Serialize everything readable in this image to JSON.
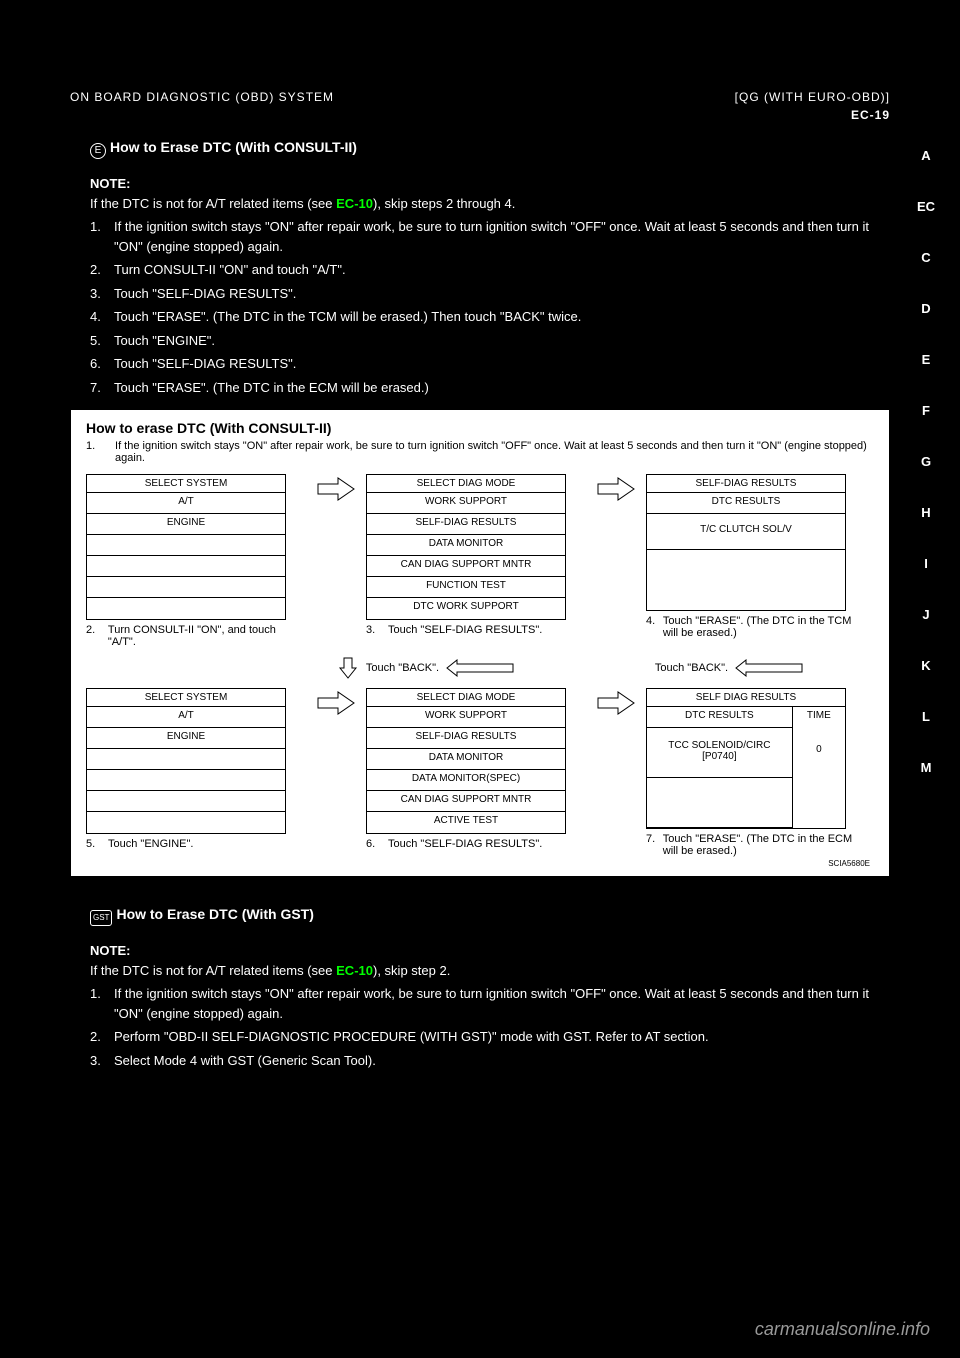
{
  "header": {
    "left": "ON BOARD DIAGNOSTIC (OBD) SYSTEM",
    "right": "[QG (WITH EURO-OBD)]",
    "page": "EC-19"
  },
  "section1": {
    "label": "How to Erase DTC (With CONSULT-II)",
    "noteLabel": "NOTE:",
    "noteText1": "If the DTC is not for A/T related items (see ",
    "noteLink": "EC-10",
    "noteText2": "), skip steps 2 through 4.",
    "item1": "If the ignition switch stays \"ON\" after repair work, be sure to turn ignition switch \"OFF\" once. Wait at least 5 seconds and then turn it \"ON\" (engine stopped) again.",
    "item2": "Turn CONSULT-II \"ON\" and touch \"A/T\".",
    "item3": "Touch \"SELF-DIAG RESULTS\".",
    "item4": "Touch \"ERASE\". (The DTC in the TCM will be erased.) Then touch \"BACK\" twice.",
    "item5": "Touch \"ENGINE\".",
    "item6": "Touch \"SELF-DIAG RESULTS\".",
    "item7": "Touch \"ERASE\". (The DTC in the ECM will be erased.)"
  },
  "diagram": {
    "title": "How to erase DTC (With CONSULT-II)",
    "step1": "If the ignition switch stays \"ON\" after repair work, be sure to turn ignition switch \"OFF\" once. Wait at least 5 seconds and then turn it \"ON\" (engine stopped) again.",
    "screen1": {
      "header": "SELECT SYSTEM",
      "r1": "A/T",
      "r2": "ENGINE"
    },
    "screen2": {
      "header": "SELECT DIAG MODE",
      "r1": "WORK SUPPORT",
      "r2": "SELF-DIAG RESULTS",
      "r3": "DATA MONITOR",
      "r4": "CAN DIAG SUPPORT MNTR",
      "r5": "FUNCTION TEST",
      "r6": "DTC WORK SUPPORT"
    },
    "screen3": {
      "header": "SELF-DIAG RESULTS",
      "sub": "DTC RESULTS",
      "r1": "T/C  CLUTCH SOL/V"
    },
    "cap2": "Turn CONSULT-II \"ON\", and touch \"A/T\".",
    "cap3": "Touch \"SELF-DIAG RESULTS\".",
    "cap4": "Touch \"ERASE\". (The DTC in the TCM will be erased.)",
    "back": "Touch \"BACK\".",
    "screen4": {
      "header": "SELECT SYSTEM",
      "r1": "A/T",
      "r2": "ENGINE"
    },
    "screen5": {
      "header": "SELECT DIAG MODE",
      "r1": "WORK SUPPORT",
      "r2": "SELF-DIAG RESULTS",
      "r3": "DATA MONITOR",
      "r4": "DATA MONITOR(SPEC)",
      "r5": "CAN DIAG SUPPORT MNTR",
      "r6": "ACTIVE TEST"
    },
    "screen6": {
      "header": "SELF DIAG RESULTS",
      "sub1": "DTC RESULTS",
      "sub2": "TIME",
      "r1": "TCC SOLENOID/CIRC [P0740]",
      "t1": "0"
    },
    "cap5": "Touch \"ENGINE\".",
    "cap6": "Touch \"SELF-DIAG RESULTS\".",
    "cap7": "Touch \"ERASE\". (The DTC in the ECM will be erased.)",
    "code": "SCIA5680E"
  },
  "section2": {
    "label": "How to Erase DTC (With GST)",
    "noteLabel": "NOTE:",
    "noteText1": "If the DTC is not for A/T related items (see ",
    "noteLink": "EC-10",
    "noteText2": "), skip step 2.",
    "item1": "If the ignition switch stays \"ON\" after repair work, be sure to turn ignition switch \"OFF\" once. Wait at least 5 seconds and then turn it \"ON\" (engine stopped) again.",
    "item2": "Perform \"OBD-II SELF-DIAGNOSTIC PROCEDURE (WITH GST)\" mode with GST. Refer to AT section.",
    "item3": "Select Mode 4 with GST (Generic Scan Tool)."
  },
  "tabs": [
    "A",
    "EC",
    "C",
    "D",
    "E",
    "F",
    "G",
    "H",
    "I",
    "J",
    "K",
    "L",
    "M"
  ],
  "watermark": "carmanualsonline.info"
}
